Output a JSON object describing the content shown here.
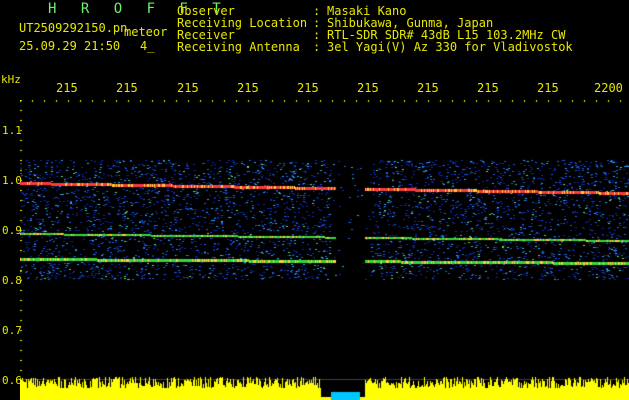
{
  "header": {
    "brand": "H R O F F T",
    "filename": "UT2509292150.pn",
    "meteor_tag": "meteor",
    "datetime": "25.09.29 21:50",
    "channel": "4_",
    "fields": [
      {
        "label": "Observer",
        "value": "Masaki Kano"
      },
      {
        "label": "Receiving Location",
        "value": "Shibukawa, Gunma, Japan"
      },
      {
        "label": "Receiver",
        "value": "RTL-SDR SDR# 43dB L15 103.2MHz CW"
      },
      {
        "label": "Receiving Antenna",
        "value": "3el Yagi(V) Az 330 for Vladivostok"
      }
    ],
    "separator": ":"
  },
  "axes": {
    "y_unit": "kHz",
    "y_ticks": [
      "1.1",
      "1.0",
      "0.9",
      "0.8",
      "0.7",
      "0.6"
    ],
    "x_ticks": [
      "215",
      "215",
      "215",
      "215",
      "215",
      "215",
      "215",
      "215",
      "215",
      "2200"
    ]
  },
  "colors": {
    "background": "#000000",
    "label": "#e8e800",
    "brand": "#6ef06e",
    "meteor_trace": "#ff3030",
    "noise_band": "#1a3fd0",
    "power_trace": "#ffff00",
    "power_gap": "#00c8ff"
  }
}
